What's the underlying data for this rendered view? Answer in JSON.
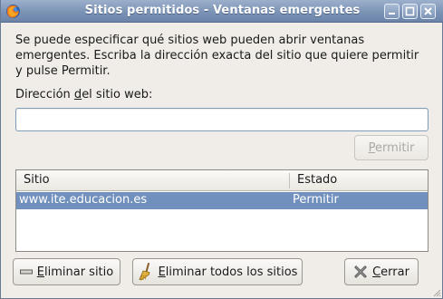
{
  "window": {
    "title": "Sitios permitidos - Ventanas emergentes"
  },
  "dialog": {
    "description": "Se puede especificar qué sitios web pueden abrir ventanas\nemergentes. Escriba la dirección exacta del sitio que quiere permitir\ny pulse Permitir.",
    "url_label_pre": "Dirección ",
    "url_label_accel": "d",
    "url_label_post": "el sitio web:",
    "url_value": "",
    "permit_accel": "P",
    "permit_rest": "ermitir"
  },
  "table": {
    "columns": [
      "Sitio",
      "Estado"
    ],
    "rows": [
      {
        "site": "www.ite.educacion.es",
        "status": "Permitir"
      }
    ]
  },
  "buttons": {
    "remove_accel": "E",
    "remove_rest": "liminar sitio",
    "remove_all_accel": "E",
    "remove_all_rest": "liminar todos los sitios",
    "close_accel": "C",
    "close_rest": "errar"
  },
  "icons": {
    "app": "firefox-icon",
    "minimize": "minimize-icon",
    "maximize": "maximize-icon",
    "close": "close-icon",
    "remove": "minus-icon",
    "remove_all": "broom-icon",
    "cerrar": "x-close-icon"
  },
  "colors": {
    "titlebar": "#7b93b5",
    "selection": "#7190bd",
    "dialog_bg": "#f0ede8"
  }
}
